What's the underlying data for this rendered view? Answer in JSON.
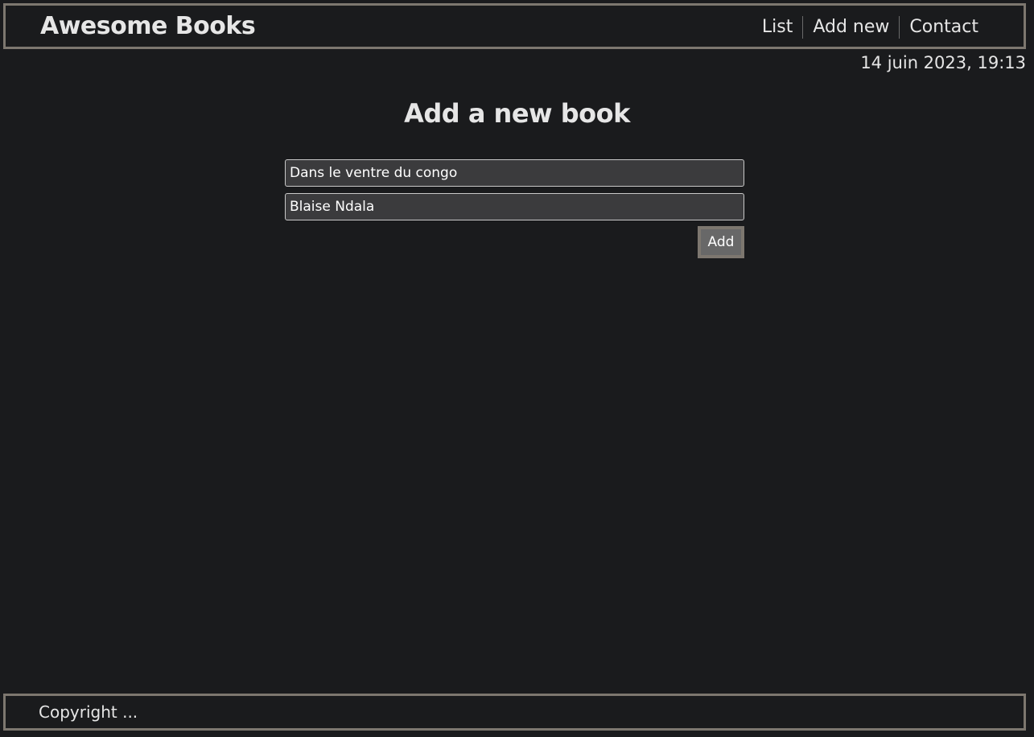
{
  "header": {
    "brand": "Awesome Books",
    "nav": [
      {
        "label": "List"
      },
      {
        "label": "Add new"
      },
      {
        "label": "Contact"
      }
    ]
  },
  "datetime": "14 juin 2023, 19:13",
  "main": {
    "title": "Add a new book",
    "form": {
      "title_value": "Dans le ventre du congo",
      "author_value": "Blaise Ndala",
      "add_label": "Add"
    }
  },
  "footer": {
    "copyright": "Copyright ..."
  },
  "colors": {
    "background": "#1a1b1d",
    "border": "#7d776f",
    "input_bg": "#3b3b3d",
    "button_bg": "#686868"
  }
}
